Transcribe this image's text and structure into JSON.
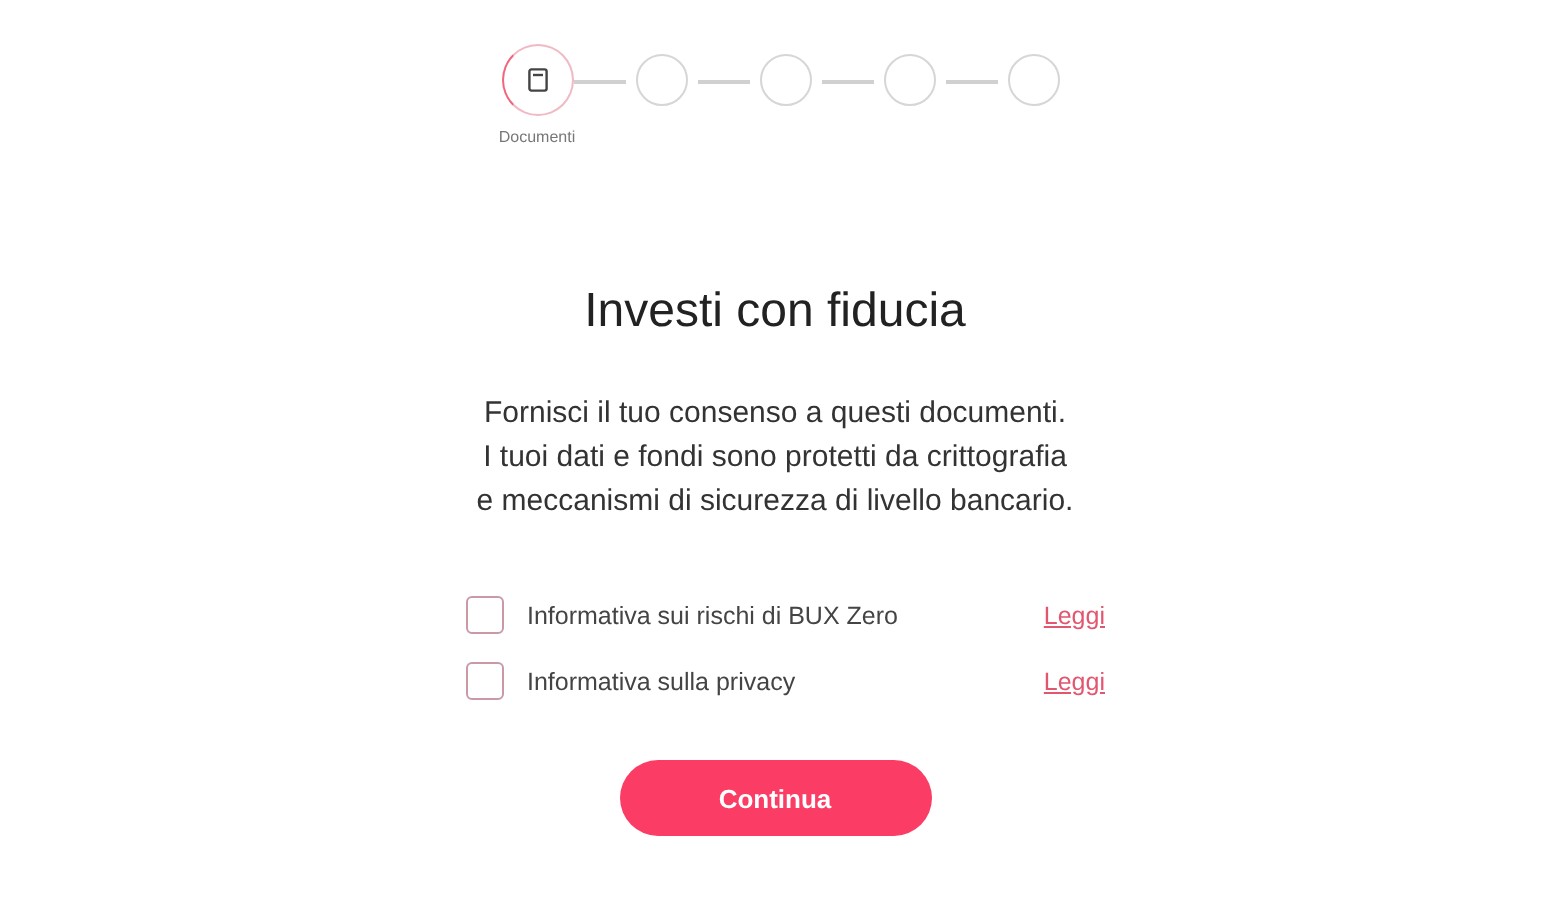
{
  "steps": [
    {
      "label": "Documenti",
      "selected": true
    },
    {
      "selected": false
    },
    {
      "selected": false
    },
    {
      "selected": false
    },
    {
      "selected": false
    }
  ],
  "title": "Investi con fiducia",
  "description": [
    "Fornisci il tuo consenso a questi documenti.",
    "I tuoi dati e fondi sono protetti da crittografia",
    "e meccanismi di sicurezza di livello bancario."
  ],
  "consents": [
    {
      "label": "Informativa sui rischi di BUX Zero",
      "checked": false,
      "link": "Leggi"
    },
    {
      "label": "Informativa sulla privacy",
      "checked": false,
      "link": "Leggi"
    }
  ],
  "button": "Continua"
}
